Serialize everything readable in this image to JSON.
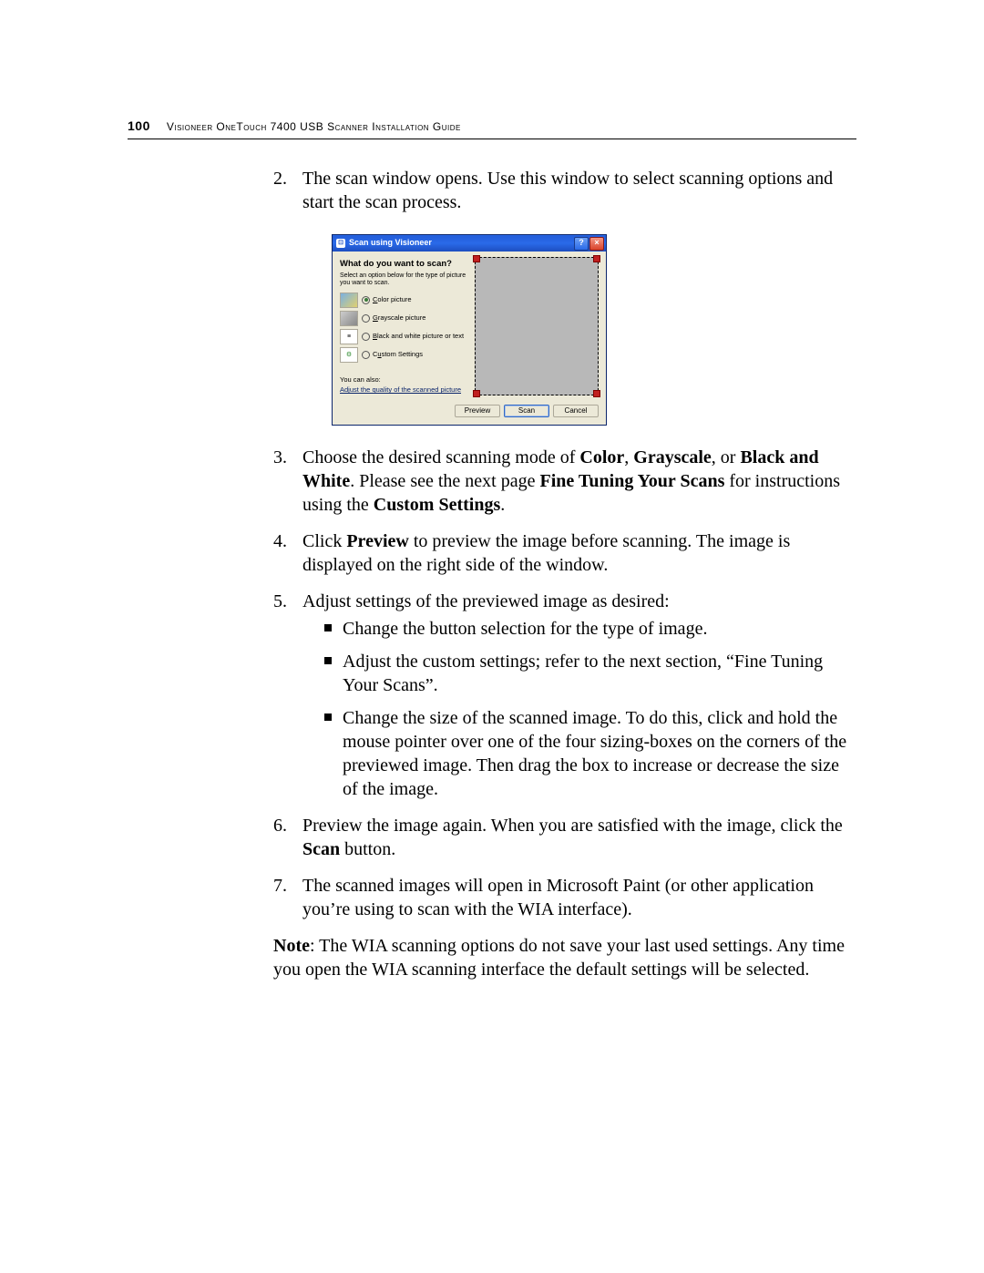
{
  "header": {
    "page_number": "100",
    "title": "Visioneer OneTouch 7400 USB Scanner Installation Guide"
  },
  "steps": {
    "s2": {
      "num": "2.",
      "text": "The scan window opens. Use this window to select scanning options and start the scan process."
    },
    "s3": {
      "num": "3.",
      "prefix": "Choose the desired scanning mode of ",
      "b1": "Color",
      "mid1": ", ",
      "b2": "Grayscale",
      "mid2": ", or ",
      "b3": "Black and White",
      "mid3": ". Please see the next page ",
      "b4": "Fine Tuning Your Scans",
      "mid4": " for instructions using the ",
      "b5": "Custom Settings",
      "suffix": "."
    },
    "s4": {
      "num": "4.",
      "prefix": "Click ",
      "b1": "Preview",
      "suffix": " to preview the image before scanning. The image is displayed on the right side of the window."
    },
    "s5": {
      "num": "5.",
      "text": "Adjust settings of the previewed image as desired:",
      "bullets": {
        "b1": "Change the button selection for the type of image.",
        "b2": "Adjust the custom settings; refer to the next section, “Fine Tuning Your Scans”.",
        "b3": "Change the size of the scanned image. To do this, click and hold the mouse pointer over one of the four sizing-boxes on the corners of the previewed image. Then drag the box to increase or decrease the size of the image."
      }
    },
    "s6": {
      "num": "6.",
      "prefix": "Preview the image again. When you are satisfied with the image, click the ",
      "b1": "Scan",
      "suffix": " button."
    },
    "s7": {
      "num": "7.",
      "text": "The scanned images will open in Microsoft Paint (or other application you’re using to scan with the WIA interface)."
    }
  },
  "note": {
    "b": "Note",
    "text": ": The WIA scanning options do not save your last used settings. Any time you open the WIA scanning interface the default settings will be selected."
  },
  "dialog": {
    "title": "Scan using Visioneer",
    "question": "What do you want to scan?",
    "instruction": "Select an option below for the type of picture you want to scan.",
    "opt_color": "Color picture",
    "opt_gray": "Grayscale picture",
    "opt_bw": "Black and white picture or text",
    "opt_custom": "Custom Settings",
    "youcan": "You can also:",
    "link": "Adjust the quality of the scanned picture",
    "btn_preview": "Preview",
    "btn_scan": "Scan",
    "btn_cancel": "Cancel"
  }
}
